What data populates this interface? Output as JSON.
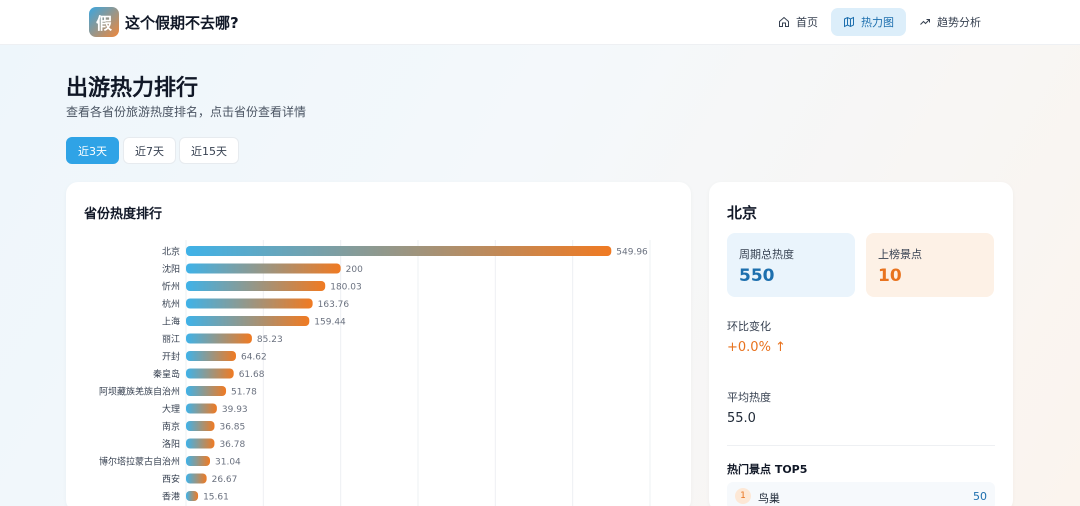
{
  "app": {
    "logo_char": "假",
    "title": "这个假期不去哪?"
  },
  "nav": [
    {
      "label": "首页",
      "icon": "home-icon"
    },
    {
      "label": "热力图",
      "icon": "map-icon",
      "active": true
    },
    {
      "label": "趋势分析",
      "icon": "trend-icon"
    }
  ],
  "hero": {
    "title": "出游热力排行",
    "subtitle": "查看各省份旅游热度排名，点击省份查看详情"
  },
  "ranges": [
    {
      "label": "近3天",
      "active": true
    },
    {
      "label": "近7天"
    },
    {
      "label": "近15天"
    }
  ],
  "chart_card": {
    "title": "省份热度排行"
  },
  "chart_data": {
    "type": "bar",
    "orientation": "horizontal",
    "categories": [
      "北京",
      "沈阳",
      "忻州",
      "杭州",
      "上海",
      "丽江",
      "开封",
      "秦皇岛",
      "阿坝藏族羌族自治州",
      "大理",
      "南京",
      "洛阳",
      "博尔塔拉蒙古自治州",
      "西安",
      "香港"
    ],
    "values": [
      549.96,
      200,
      180.03,
      163.76,
      159.44,
      85.23,
      64.62,
      61.68,
      51.78,
      39.93,
      36.85,
      36.78,
      31.04,
      26.67,
      15.61
    ],
    "value_labels": [
      "549.96",
      "200",
      "180.03",
      "163.76",
      "159.44",
      "85.23",
      "64.62",
      "61.68",
      "51.78",
      "39.93",
      "36.85",
      "36.78",
      "31.04",
      "26.67",
      "15.61"
    ],
    "xlim": [
      0,
      600
    ],
    "grid": true,
    "bar_gradient": [
      "#3fb2e8",
      "#f07a22"
    ]
  },
  "detail": {
    "title": "北京",
    "total_label": "周期总热度",
    "total_value": "550",
    "spots_label": "上榜景点",
    "spots_value": "10",
    "change_label": "环比变化",
    "change_value": "+0.0% ↑",
    "avg_label": "平均热度",
    "avg_value": "55.0",
    "top5_title": "热门景点 TOP5",
    "top_items": [
      {
        "rank": "1",
        "name": "鸟巢",
        "score": "50"
      }
    ]
  },
  "colors": {
    "accent": "#2fa3e6",
    "orange": "#e8731f"
  }
}
